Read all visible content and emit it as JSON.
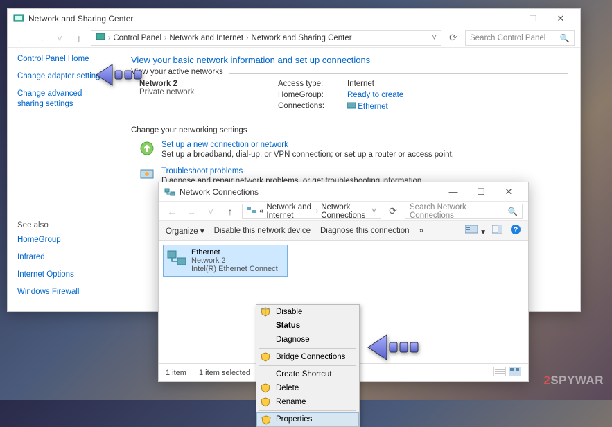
{
  "win1": {
    "title": "Network and Sharing Center",
    "breadcrumb": [
      "Control Panel",
      "Network and Internet",
      "Network and Sharing Center"
    ],
    "search_placeholder": "Search Control Panel",
    "sidebar": {
      "home": "Control Panel Home",
      "items": [
        "Change adapter settings",
        "Change advanced sharing settings"
      ],
      "seealso_title": "See also",
      "seealso": [
        "HomeGroup",
        "Infrared",
        "Internet Options",
        "Windows Firewall"
      ]
    },
    "heading": "View your basic network information and set up connections",
    "active_label": "View your active networks",
    "network": {
      "name": "Network  2",
      "type": "Private network",
      "access_label": "Access type:",
      "access_value": "Internet",
      "hg_label": "HomeGroup:",
      "hg_value": "Ready to create",
      "conn_label": "Connections:",
      "conn_value": "Ethernet"
    },
    "changesettings_label": "Change your networking settings",
    "settings": [
      {
        "title": "Set up a new connection or network",
        "desc": "Set up a broadband, dial-up, or VPN connection; or set up a router or access point."
      },
      {
        "title": "Troubleshoot problems",
        "desc": "Diagnose and repair network problems, or get troubleshooting information."
      }
    ]
  },
  "win2": {
    "title": "Network Connections",
    "breadcrumb": [
      "Network and Internet",
      "Network Connections"
    ],
    "breadcrumb_prefix": "«",
    "search_placeholder": "Search Network Connections",
    "toolbar": {
      "organize": "Organize",
      "disable": "Disable this network device",
      "diagnose": "Diagnose this connection",
      "more": "»"
    },
    "item": {
      "name": "Ethernet",
      "sub1": "Network  2",
      "sub2": "Intel(R) Ethernet Connect"
    },
    "context": [
      {
        "label": "Disable",
        "shield": true
      },
      {
        "label": "Status",
        "shield": false
      },
      {
        "label": "Diagnose",
        "shield": false
      },
      {
        "sep": true
      },
      {
        "label": "Bridge Connections",
        "shield": true
      },
      {
        "sep": true
      },
      {
        "label": "Create Shortcut",
        "shield": false
      },
      {
        "label": "Delete",
        "shield": true
      },
      {
        "label": "Rename",
        "shield": true
      },
      {
        "sep": true
      },
      {
        "label": "Properties",
        "shield": true,
        "highlight": true
      }
    ],
    "status": {
      "left": "1 item",
      "right": "1 item selected"
    }
  },
  "watermark": {
    "num": "2",
    "text": "SPYWAR"
  }
}
